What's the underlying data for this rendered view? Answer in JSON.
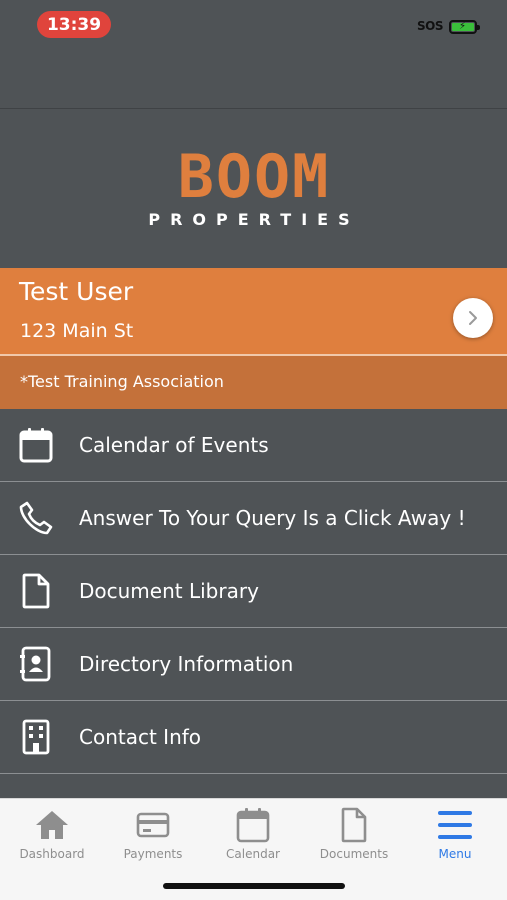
{
  "status_bar": {
    "time": "13:39",
    "sos": "SOS"
  },
  "logo": {
    "wordmark": "BOOM",
    "subtitle": "PROPERTIES"
  },
  "user": {
    "name": "Test User",
    "address": "123 Main St",
    "association": "*Test Training Association"
  },
  "menu": {
    "items": [
      {
        "label": "Calendar of Events",
        "icon": "calendar-icon"
      },
      {
        "label": "Answer To Your Query Is a Click Away !",
        "icon": "phone-icon"
      },
      {
        "label": "Document Library",
        "icon": "document-icon"
      },
      {
        "label": "Directory Information",
        "icon": "contact-book-icon"
      },
      {
        "label": "Contact Info",
        "icon": "building-icon"
      }
    ]
  },
  "tabs": {
    "items": [
      {
        "label": "Dashboard",
        "icon": "home-icon"
      },
      {
        "label": "Payments",
        "icon": "credit-card-icon"
      },
      {
        "label": "Calendar",
        "icon": "calendar-icon"
      },
      {
        "label": "Documents",
        "icon": "document-icon"
      },
      {
        "label": "Menu",
        "icon": "hamburger-icon",
        "active": true
      }
    ]
  },
  "colors": {
    "background": "#4f5356",
    "brand_orange": "#df7f3e",
    "association_orange": "#c4713a",
    "active_tab": "#2f7ae5",
    "inactive_tab": "#8e8e8e"
  }
}
